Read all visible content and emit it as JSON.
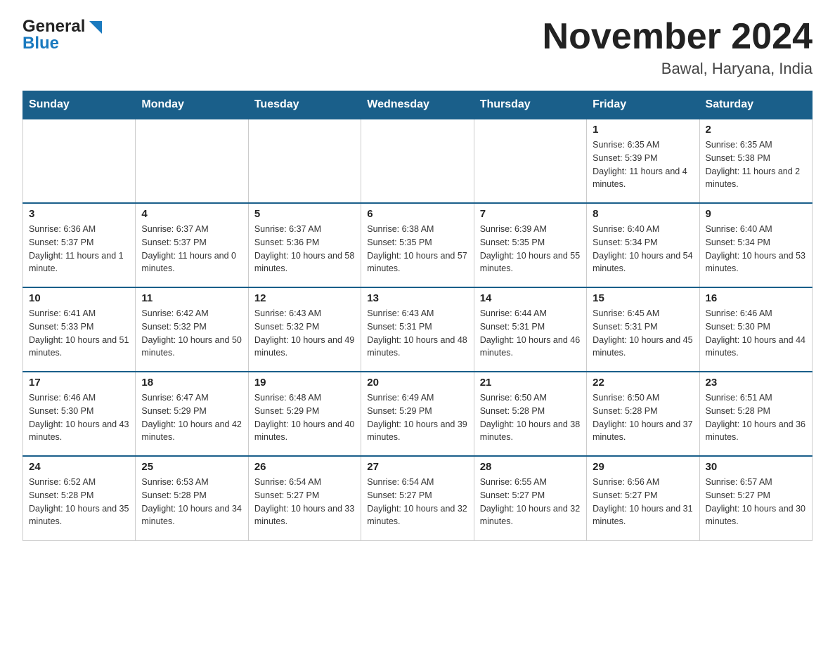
{
  "header": {
    "logo_general": "General",
    "logo_blue": "Blue",
    "main_title": "November 2024",
    "subtitle": "Bawal, Haryana, India"
  },
  "days_of_week": [
    "Sunday",
    "Monday",
    "Tuesday",
    "Wednesday",
    "Thursday",
    "Friday",
    "Saturday"
  ],
  "weeks": [
    {
      "cells": [
        {
          "day": null
        },
        {
          "day": null
        },
        {
          "day": null
        },
        {
          "day": null
        },
        {
          "day": null
        },
        {
          "day": "1",
          "sunrise": "6:35 AM",
          "sunset": "5:39 PM",
          "daylight": "11 hours and 4 minutes."
        },
        {
          "day": "2",
          "sunrise": "6:35 AM",
          "sunset": "5:38 PM",
          "daylight": "11 hours and 2 minutes."
        }
      ]
    },
    {
      "cells": [
        {
          "day": "3",
          "sunrise": "6:36 AM",
          "sunset": "5:37 PM",
          "daylight": "11 hours and 1 minute."
        },
        {
          "day": "4",
          "sunrise": "6:37 AM",
          "sunset": "5:37 PM",
          "daylight": "11 hours and 0 minutes."
        },
        {
          "day": "5",
          "sunrise": "6:37 AM",
          "sunset": "5:36 PM",
          "daylight": "10 hours and 58 minutes."
        },
        {
          "day": "6",
          "sunrise": "6:38 AM",
          "sunset": "5:35 PM",
          "daylight": "10 hours and 57 minutes."
        },
        {
          "day": "7",
          "sunrise": "6:39 AM",
          "sunset": "5:35 PM",
          "daylight": "10 hours and 55 minutes."
        },
        {
          "day": "8",
          "sunrise": "6:40 AM",
          "sunset": "5:34 PM",
          "daylight": "10 hours and 54 minutes."
        },
        {
          "day": "9",
          "sunrise": "6:40 AM",
          "sunset": "5:34 PM",
          "daylight": "10 hours and 53 minutes."
        }
      ]
    },
    {
      "cells": [
        {
          "day": "10",
          "sunrise": "6:41 AM",
          "sunset": "5:33 PM",
          "daylight": "10 hours and 51 minutes."
        },
        {
          "day": "11",
          "sunrise": "6:42 AM",
          "sunset": "5:32 PM",
          "daylight": "10 hours and 50 minutes."
        },
        {
          "day": "12",
          "sunrise": "6:43 AM",
          "sunset": "5:32 PM",
          "daylight": "10 hours and 49 minutes."
        },
        {
          "day": "13",
          "sunrise": "6:43 AM",
          "sunset": "5:31 PM",
          "daylight": "10 hours and 48 minutes."
        },
        {
          "day": "14",
          "sunrise": "6:44 AM",
          "sunset": "5:31 PM",
          "daylight": "10 hours and 46 minutes."
        },
        {
          "day": "15",
          "sunrise": "6:45 AM",
          "sunset": "5:31 PM",
          "daylight": "10 hours and 45 minutes."
        },
        {
          "day": "16",
          "sunrise": "6:46 AM",
          "sunset": "5:30 PM",
          "daylight": "10 hours and 44 minutes."
        }
      ]
    },
    {
      "cells": [
        {
          "day": "17",
          "sunrise": "6:46 AM",
          "sunset": "5:30 PM",
          "daylight": "10 hours and 43 minutes."
        },
        {
          "day": "18",
          "sunrise": "6:47 AM",
          "sunset": "5:29 PM",
          "daylight": "10 hours and 42 minutes."
        },
        {
          "day": "19",
          "sunrise": "6:48 AM",
          "sunset": "5:29 PM",
          "daylight": "10 hours and 40 minutes."
        },
        {
          "day": "20",
          "sunrise": "6:49 AM",
          "sunset": "5:29 PM",
          "daylight": "10 hours and 39 minutes."
        },
        {
          "day": "21",
          "sunrise": "6:50 AM",
          "sunset": "5:28 PM",
          "daylight": "10 hours and 38 minutes."
        },
        {
          "day": "22",
          "sunrise": "6:50 AM",
          "sunset": "5:28 PM",
          "daylight": "10 hours and 37 minutes."
        },
        {
          "day": "23",
          "sunrise": "6:51 AM",
          "sunset": "5:28 PM",
          "daylight": "10 hours and 36 minutes."
        }
      ]
    },
    {
      "cells": [
        {
          "day": "24",
          "sunrise": "6:52 AM",
          "sunset": "5:28 PM",
          "daylight": "10 hours and 35 minutes."
        },
        {
          "day": "25",
          "sunrise": "6:53 AM",
          "sunset": "5:28 PM",
          "daylight": "10 hours and 34 minutes."
        },
        {
          "day": "26",
          "sunrise": "6:54 AM",
          "sunset": "5:27 PM",
          "daylight": "10 hours and 33 minutes."
        },
        {
          "day": "27",
          "sunrise": "6:54 AM",
          "sunset": "5:27 PM",
          "daylight": "10 hours and 32 minutes."
        },
        {
          "day": "28",
          "sunrise": "6:55 AM",
          "sunset": "5:27 PM",
          "daylight": "10 hours and 32 minutes."
        },
        {
          "day": "29",
          "sunrise": "6:56 AM",
          "sunset": "5:27 PM",
          "daylight": "10 hours and 31 minutes."
        },
        {
          "day": "30",
          "sunrise": "6:57 AM",
          "sunset": "5:27 PM",
          "daylight": "10 hours and 30 minutes."
        }
      ]
    }
  ]
}
